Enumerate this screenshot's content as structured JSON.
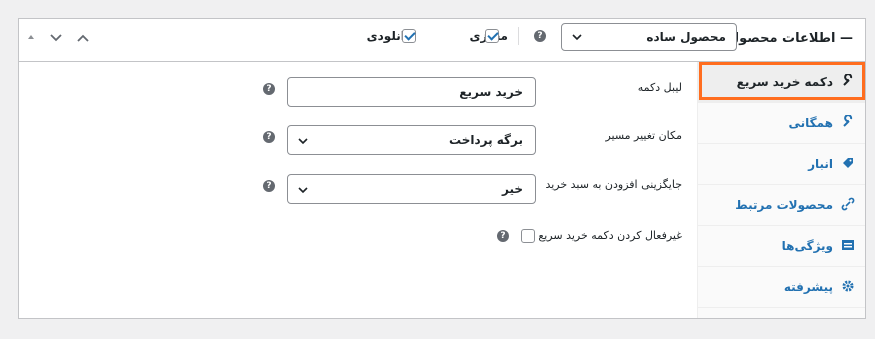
{
  "header": {
    "title": "اطلاعات محصول —",
    "product_type": "محصول ساده",
    "virtual_label": "مجازی",
    "virtual_checked": true,
    "downloadable_label": "دانلودی",
    "downloadable_checked": true
  },
  "tabs": [
    {
      "label": "دکمه خرید سریع",
      "icon": "wrench-icon",
      "active": true
    },
    {
      "label": "همگانی",
      "icon": "wrench-icon",
      "active": false
    },
    {
      "label": "انبار",
      "icon": "tag-icon",
      "active": false
    },
    {
      "label": "محصولات مرتبط",
      "icon": "link-icon",
      "active": false
    },
    {
      "label": "ویژگی‌ها",
      "icon": "list-icon",
      "active": false
    },
    {
      "label": "پیشرفته",
      "icon": "gear-icon",
      "active": false
    }
  ],
  "fields": {
    "button_label": {
      "label": "لیبل دکمه",
      "value": "خرید سریع"
    },
    "redirect": {
      "label": "مکان تغییر مسیر",
      "value": "برگه پرداخت"
    },
    "replace_add_to_cart": {
      "label": "جایگزینی افزودن به سبد خرید",
      "value": "خیر"
    },
    "disable_quick_buy": {
      "label": "غیرفعال کردن دکمه خرید سریع",
      "checked": false
    }
  },
  "colors": {
    "accent": "#2271b1",
    "highlight": "#ff6d1f"
  }
}
